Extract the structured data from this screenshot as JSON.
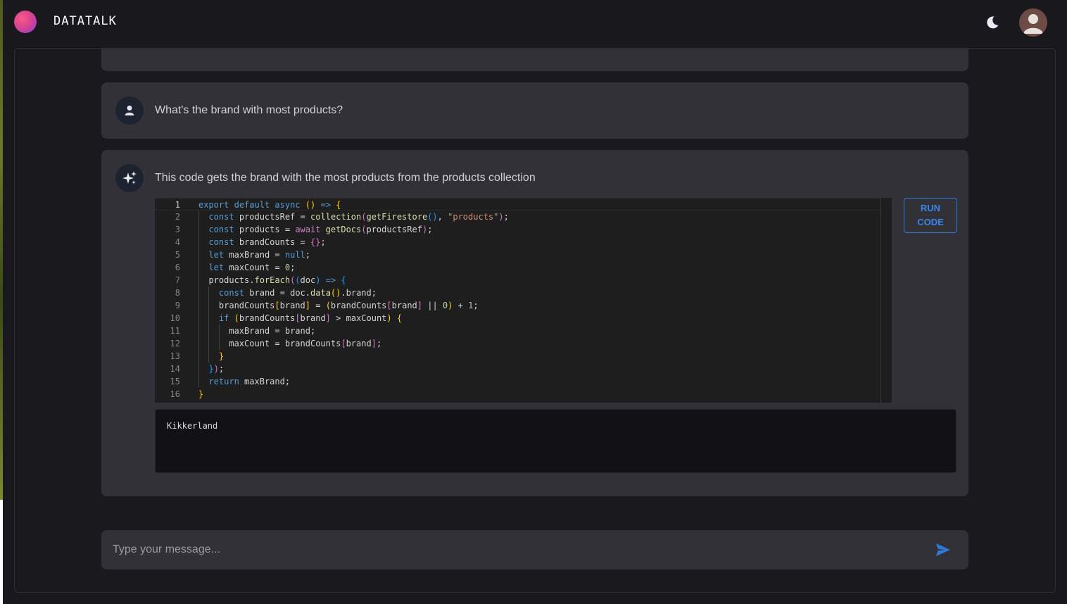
{
  "header": {
    "brand": "DATATALK",
    "theme_icon": "moon-icon",
    "avatar_icon": "user-avatar-icon"
  },
  "chat": {
    "user_message": {
      "icon": "person-icon",
      "text": "What's the brand with most products?"
    },
    "assistant_message": {
      "icon": "sparkles-icon",
      "text": "This code gets the brand with the most products from the products collection",
      "run_button_line1": "RUN",
      "run_button_line2": "CODE",
      "code_lines": [
        "export default async () => {",
        "  const productsRef = collection(getFirestore(), \"products\");",
        "  const products = await getDocs(productsRef);",
        "  const brandCounts = {};",
        "  let maxBrand = null;",
        "  let maxCount = 0;",
        "  products.forEach((doc) => {",
        "    const brand = doc.data().brand;",
        "    brandCounts[brand] = (brandCounts[brand] || 0) + 1;",
        "    if (brandCounts[brand] > maxCount) {",
        "      maxBrand = brand;",
        "      maxCount = brandCounts[brand];",
        "    }",
        "  });",
        "  return maxBrand;",
        "}"
      ],
      "line_numbers": [
        "1",
        "2",
        "3",
        "4",
        "5",
        "6",
        "7",
        "8",
        "9",
        "10",
        "11",
        "12",
        "13",
        "14",
        "15",
        "16"
      ],
      "output": "Kikkerland"
    }
  },
  "composer": {
    "placeholder": "Type your message...",
    "send_icon": "send-icon"
  },
  "colors": {
    "accent": "#2f78d8",
    "background": "#19181d",
    "card": "#323138",
    "code_background": "#1e1e1e"
  }
}
